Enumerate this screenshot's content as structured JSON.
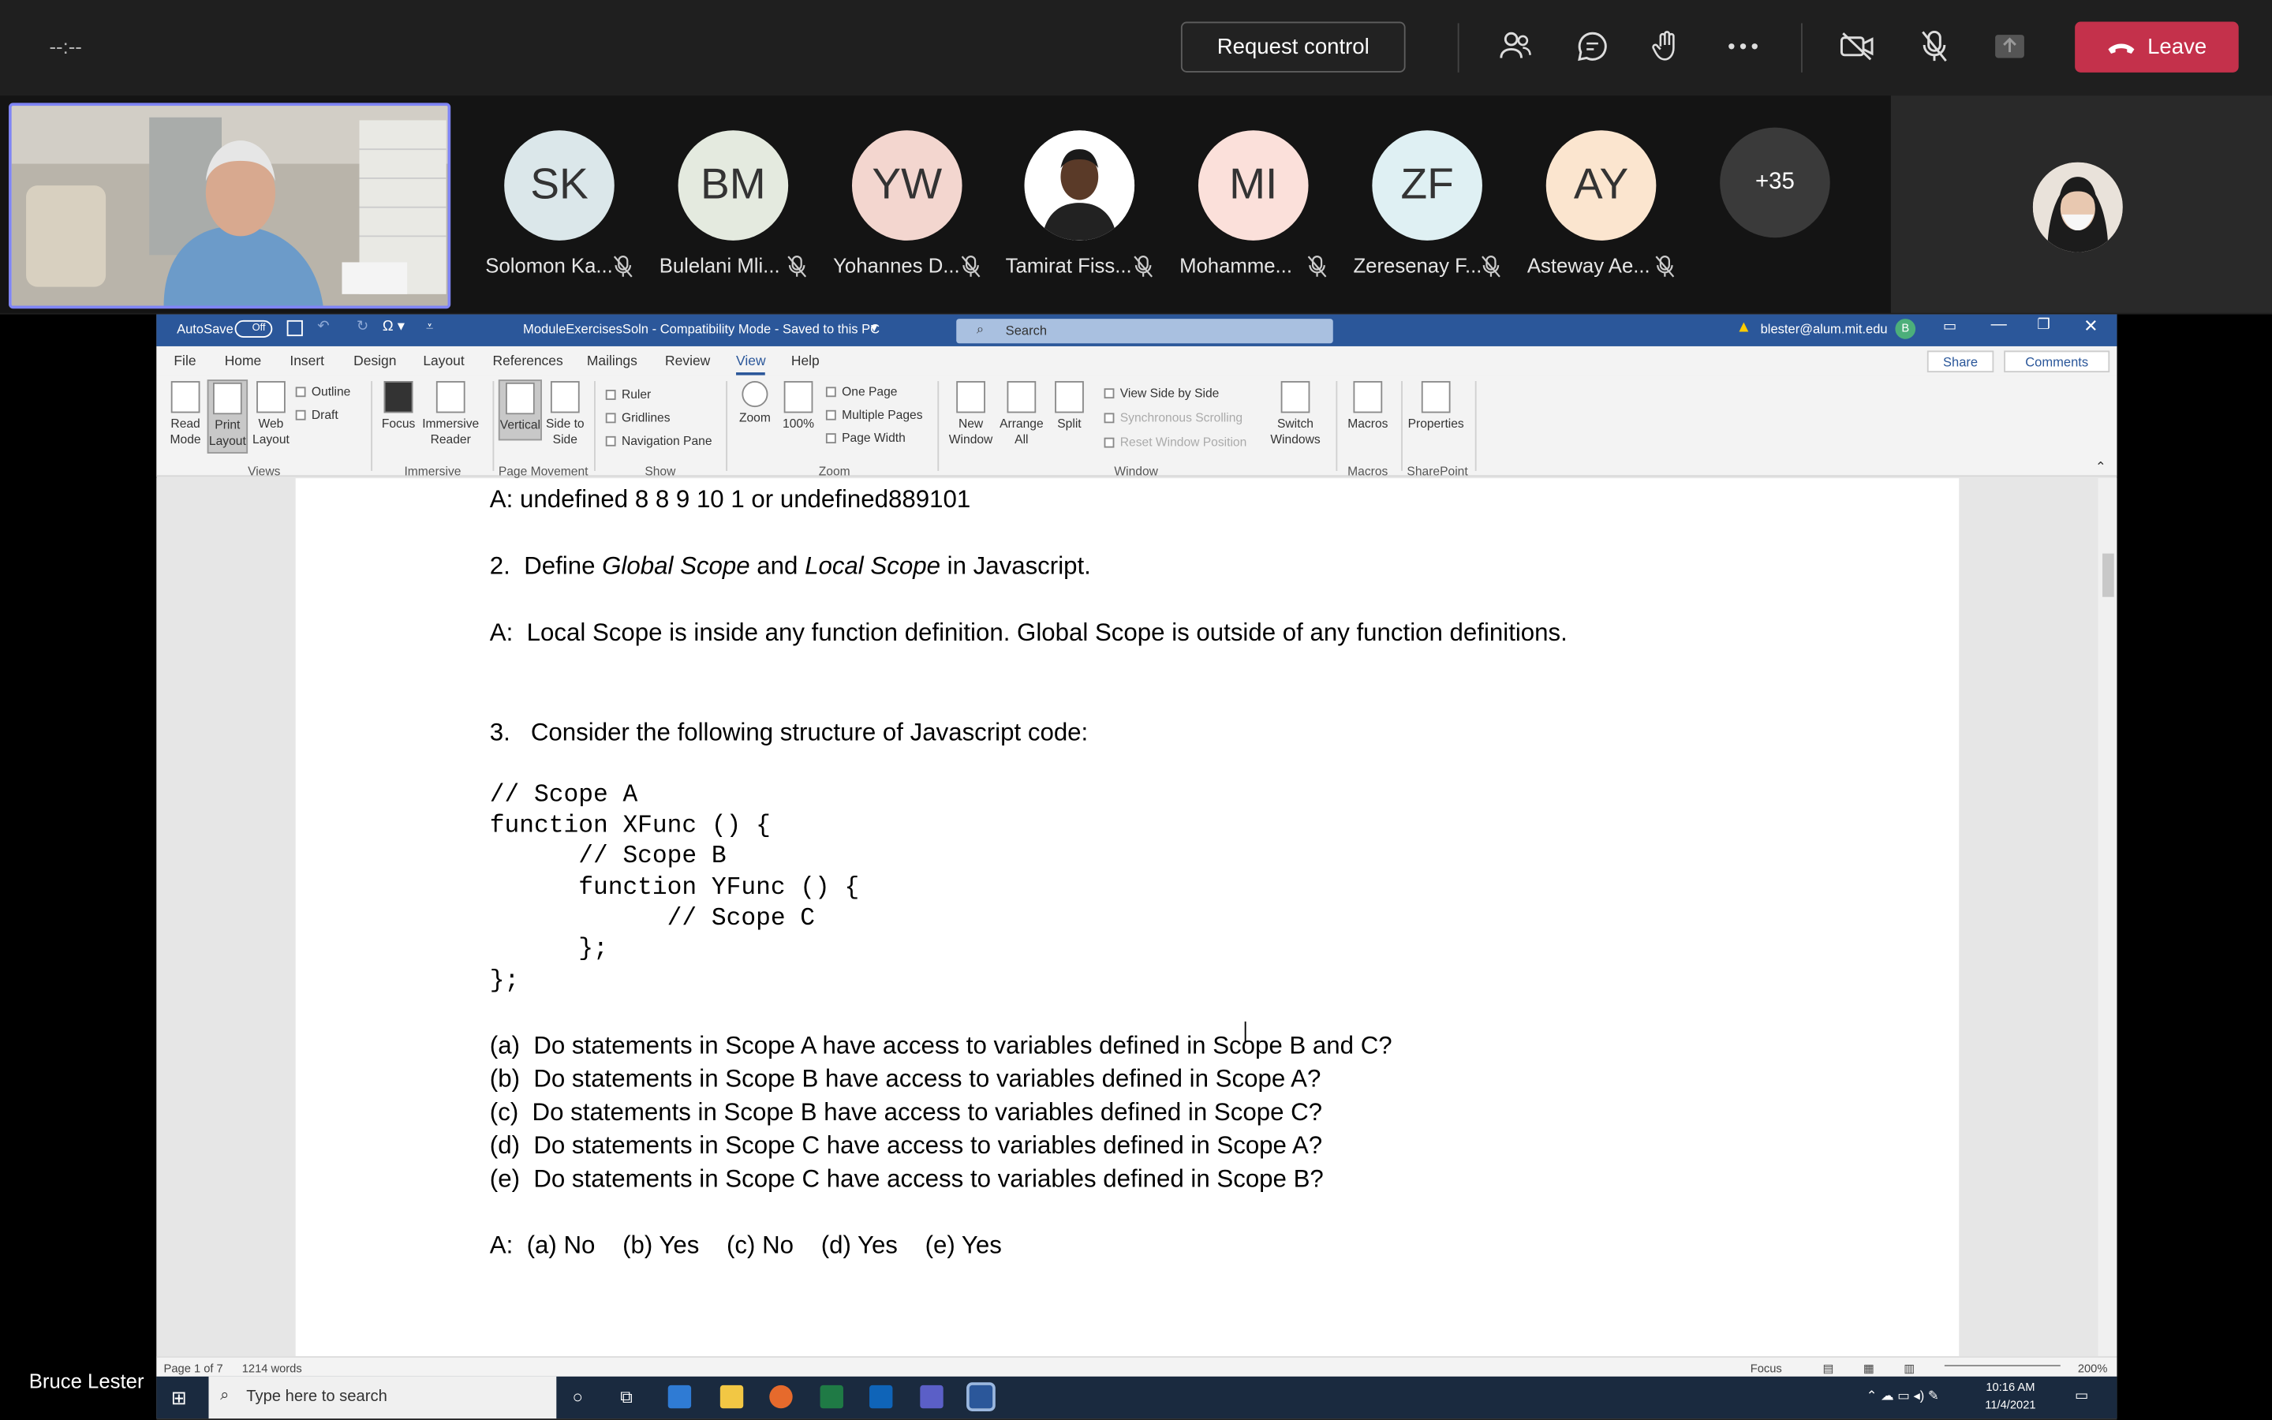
{
  "meeting": {
    "timer": "--:--",
    "request_control_label": "Request control",
    "leave_label": "Leave",
    "presenter_name": "Bruce Lester",
    "accent_color": "#7f85f5",
    "leave_color": "#c4314b"
  },
  "participants": [
    {
      "initials": "SK",
      "name": "Solomon Ka...",
      "color": "#dbe7ea"
    },
    {
      "initials": "BM",
      "name": "Bulelani Mli...",
      "color": "#e4eadf"
    },
    {
      "initials": "YW",
      "name": "Yohannes D...",
      "color": "#f3d6cf"
    },
    {
      "initials": "",
      "name": "Tamirat Fiss...",
      "color": "#ffffff"
    },
    {
      "initials": "MI",
      "name": "Mohamme...",
      "color": "#fbe0da"
    },
    {
      "initials": "ZF",
      "name": "Zeresenay F...",
      "color": "#dff0f3"
    },
    {
      "initials": "AY",
      "name": "Asteway Ae...",
      "color": "#fbe5cf"
    }
  ],
  "more_participants": "+35",
  "word": {
    "autosave": "AutoSave",
    "autosave_state": "Off",
    "doc_title": "ModuleExercisesSoln  -  Compatibility Mode  -  Saved to this PC",
    "search_placeholder": "Search",
    "account": "blester@alum.mit.edu",
    "account_initial": "B",
    "tabs": [
      "File",
      "Home",
      "Insert",
      "Design",
      "Layout",
      "References",
      "Mailings",
      "Review",
      "View",
      "Help"
    ],
    "active_tab": "View",
    "share_label": "Share",
    "comments_label": "Comments",
    "ribbon": {
      "read_mode": "Read Mode",
      "print_layout": "Print Layout",
      "web_layout": "Web Layout",
      "outline": "Outline",
      "draft": "Draft",
      "views_group": "Views",
      "focus": "Focus",
      "immersive_reader": "Immersive Reader",
      "immersive_group": "Immersive",
      "vertical": "Vertical",
      "side_to_side": "Side to Side",
      "page_movement_group": "Page Movement",
      "ruler": "Ruler",
      "gridlines": "Gridlines",
      "navigation_pane": "Navigation Pane",
      "show_group": "Show",
      "zoom": "Zoom",
      "hundred": "100%",
      "one_page": "One Page",
      "multiple_pages": "Multiple Pages",
      "page_width": "Page Width",
      "zoom_group": "Zoom",
      "new_window": "New Window",
      "arrange_all": "Arrange All",
      "split": "Split",
      "view_side_by_side": "View Side by Side",
      "sync_scrolling": "Synchronous Scrolling",
      "reset_window": "Reset Window Position",
      "switch_windows": "Switch Windows",
      "window_group": "Window",
      "macros": "Macros",
      "macros_group": "Macros",
      "properties": "Properties",
      "sharepoint_group": "SharePoint"
    },
    "document": {
      "line1": "A: undefined 8 8 9 10 1 or undefined889101",
      "q2_prefix": "2.  Define ",
      "q2_global": "Global Scope",
      "q2_and": " and ",
      "q2_local": "Local Scope",
      "q2_suffix": " in Javascript.",
      "a2": "A:  Local Scope is inside any function definition. Global Scope is outside of any function definitions.",
      "q3": "3.   Consider the following structure of Javascript code:",
      "code": [
        "// Scope A",
        "function XFunc () {",
        "      // Scope B",
        "      function YFunc () {",
        "            // Scope C",
        "      };",
        "};"
      ],
      "questions": [
        "(a)  Do statements in Scope A have access to variables defined in Scope B and C?",
        "(b)  Do statements in Scope B have access to variables defined in Scope A?",
        "(c)  Do statements in Scope B have access to variables defined in Scope C?",
        "(d)  Do statements in Scope C have access to variables defined in Scope A?",
        "(e)  Do statements in Scope C have access to variables defined in Scope B?"
      ],
      "answer": "A:  (a) No    (b) Yes    (c) No    (d) Yes    (e) Yes"
    },
    "status": {
      "page": "Page 1 of 7",
      "words": "1214 words",
      "focus": "Focus",
      "zoom": "200%"
    },
    "brand_color": "#2b579a"
  },
  "taskbar": {
    "search_placeholder": "Type here to search",
    "time": "10:16 AM",
    "date": "11/4/2021"
  }
}
